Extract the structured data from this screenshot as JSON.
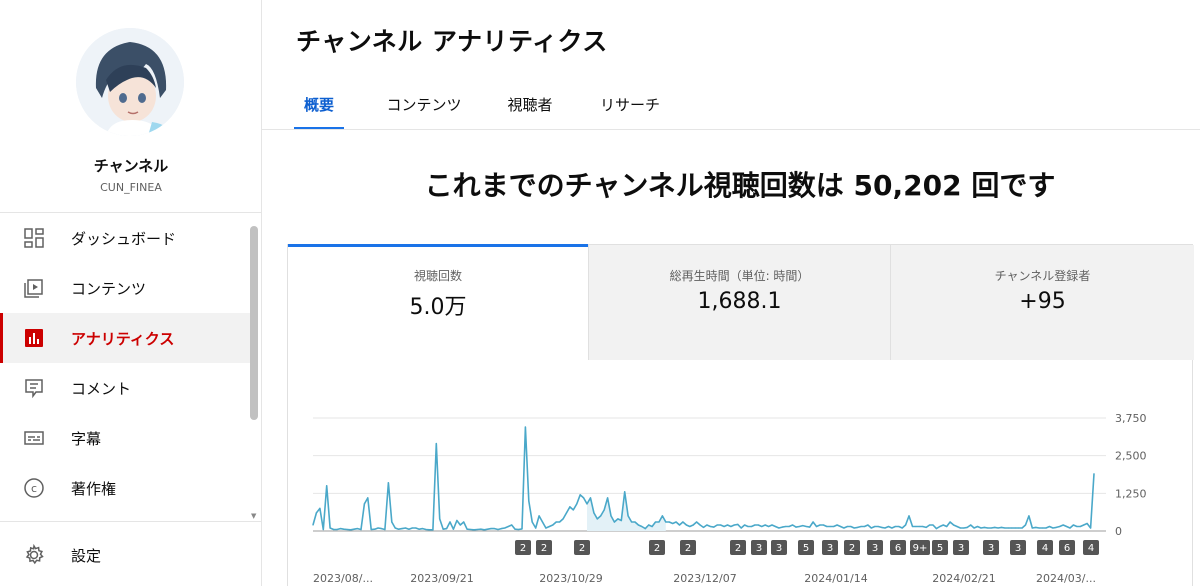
{
  "sidebar": {
    "channel_name": "チャンネル",
    "channel_handle": "CUN_FINEA",
    "items": [
      {
        "label": "ダッシュボード",
        "icon": "dashboard-icon"
      },
      {
        "label": "コンテンツ",
        "icon": "content-icon"
      },
      {
        "label": "アナリティクス",
        "icon": "analytics-icon",
        "active": true
      },
      {
        "label": "コメント",
        "icon": "comment-icon"
      },
      {
        "label": "字幕",
        "icon": "subtitles-icon"
      },
      {
        "label": "著作権",
        "icon": "copyright-icon"
      }
    ],
    "settings_label": "設定"
  },
  "header": {
    "title": "チャンネル アナリティクス"
  },
  "tabs": [
    {
      "label": "概要",
      "active": true
    },
    {
      "label": "コンテンツ"
    },
    {
      "label": "視聴者"
    },
    {
      "label": "リサーチ"
    }
  ],
  "headline": "これまでのチャンネル視聴回数は 50,202 回です",
  "metrics": [
    {
      "label": "視聴回数",
      "value": "5.0万",
      "active": true
    },
    {
      "label": "総再生時間（単位: 時間）",
      "value": "1,688.1"
    },
    {
      "label": "チャンネル登録者",
      "value": "+95"
    }
  ],
  "colors": {
    "accent": "#1a73e8",
    "brand_red": "#cc0000",
    "line": "#4aa8c9"
  },
  "chart_data": {
    "type": "line",
    "series": [
      {
        "values": [
          200,
          600,
          750,
          50,
          1500,
          100,
          50,
          50,
          80,
          60,
          50,
          40,
          60,
          80,
          50,
          900,
          1100,
          50,
          60,
          100,
          80,
          50,
          1600,
          300,
          100,
          60,
          80,
          100,
          60,
          100,
          100,
          60,
          80,
          50,
          40,
          40,
          2900,
          400,
          60,
          80,
          300,
          60,
          350,
          200,
          300,
          60,
          50,
          40,
          50,
          60,
          40,
          60,
          80,
          80,
          50,
          80,
          100,
          150,
          200,
          60,
          50,
          70,
          3450,
          1000,
          300,
          100,
          500,
          300,
          100,
          150,
          200,
          300,
          300,
          400,
          600,
          800,
          700,
          900,
          1200,
          1100,
          900,
          1100,
          600,
          400,
          500,
          700,
          1100,
          500,
          300,
          400,
          350,
          1300,
          500,
          300,
          300,
          200,
          150,
          80,
          200,
          150,
          300,
          300,
          500,
          300,
          300,
          250,
          300,
          200,
          300,
          200,
          150,
          200,
          300,
          200,
          120,
          200,
          150,
          130,
          200,
          200,
          150,
          200,
          150,
          200,
          220,
          100,
          200,
          150,
          150,
          200,
          200,
          150,
          200,
          150,
          200,
          150,
          100,
          130,
          150,
          150,
          200,
          130,
          150,
          180,
          150,
          130,
          300,
          150,
          200,
          200,
          150,
          150,
          150,
          200,
          150,
          100,
          150,
          150,
          100,
          120,
          150,
          150,
          200,
          100,
          150,
          150,
          120,
          100,
          150,
          100,
          150,
          150,
          100,
          200,
          500,
          150,
          150,
          150,
          150,
          120,
          200,
          200,
          80,
          150,
          200,
          150,
          300,
          200,
          150,
          100,
          100,
          120,
          200,
          100,
          150,
          100,
          120,
          100,
          100,
          120,
          100,
          120,
          100,
          100,
          100,
          100,
          100,
          100,
          200,
          500,
          100,
          120,
          100,
          100,
          100,
          150,
          100,
          120,
          150,
          200,
          150,
          100,
          200,
          150,
          150,
          200,
          250,
          100,
          1900
        ]
      }
    ],
    "x_tick_labels": [
      "2023/08/...",
      "2023/09/21",
      "2023/10/29",
      "2023/12/07",
      "2024/01/14",
      "2024/02/21",
      "2024/03/..."
    ],
    "y_ticks": [
      0,
      1250,
      2500,
      3750
    ],
    "y_tick_labels": [
      "0",
      "1,250",
      "2,500",
      "3,750"
    ],
    "ylim": [
      0,
      3750
    ],
    "grid": true,
    "markers": [
      "2",
      "2",
      "2",
      "2",
      "2",
      "2",
      "3",
      "3",
      "5",
      "3",
      "2",
      "3",
      "6",
      "9+",
      "5",
      "3",
      "3",
      "3",
      "4",
      "6",
      "4"
    ]
  }
}
